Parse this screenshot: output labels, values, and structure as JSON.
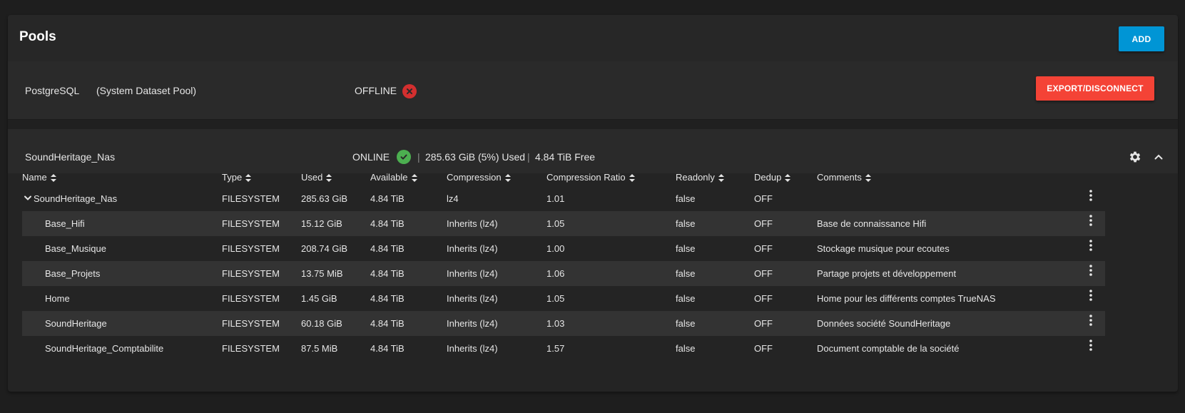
{
  "header": {
    "title": "Pools",
    "add_label": "ADD"
  },
  "offline_pool": {
    "name": "PostgreSQL",
    "subtitle": "(System Dataset Pool)",
    "status": "OFFLINE",
    "status_icon": "error-circle-icon",
    "export_label": "EXPORT/DISCONNECT"
  },
  "online_pool": {
    "name": "SoundHeritage_Nas",
    "status": "ONLINE",
    "status_icon": "check-circle-icon",
    "used": "285.63 GiB (5%) Used",
    "free": "4.84 TiB Free",
    "separator": "|"
  },
  "table": {
    "columns": [
      "Name",
      "Type",
      "Used",
      "Available",
      "Compression",
      "Compression Ratio",
      "Readonly",
      "Dedup",
      "Comments"
    ],
    "rows": [
      {
        "name": "SoundHeritage_Nas",
        "type": "FILESYSTEM",
        "used": "285.63 GiB",
        "available": "4.84 TiB",
        "compression": "lz4",
        "ratio": "1.01",
        "readonly": "false",
        "dedup": "OFF",
        "comments": ""
      },
      {
        "name": "Base_Hifi",
        "type": "FILESYSTEM",
        "used": "15.12 GiB",
        "available": "4.84 TiB",
        "compression": "Inherits (lz4)",
        "ratio": "1.05",
        "readonly": "false",
        "dedup": "OFF",
        "comments": "Base de connaissance Hifi"
      },
      {
        "name": "Base_Musique",
        "type": "FILESYSTEM",
        "used": "208.74 GiB",
        "available": "4.84 TiB",
        "compression": "Inherits (lz4)",
        "ratio": "1.00",
        "readonly": "false",
        "dedup": "OFF",
        "comments": "Stockage musique pour ecoutes"
      },
      {
        "name": "Base_Projets",
        "type": "FILESYSTEM",
        "used": "13.75 MiB",
        "available": "4.84 TiB",
        "compression": "Inherits (lz4)",
        "ratio": "1.06",
        "readonly": "false",
        "dedup": "OFF",
        "comments": "Partage projets et développement"
      },
      {
        "name": "Home",
        "type": "FILESYSTEM",
        "used": "1.45 GiB",
        "available": "4.84 TiB",
        "compression": "Inherits (lz4)",
        "ratio": "1.05",
        "readonly": "false",
        "dedup": "OFF",
        "comments": "Home pour les différents comptes TrueNAS"
      },
      {
        "name": "SoundHeritage",
        "type": "FILESYSTEM",
        "used": "60.18 GiB",
        "available": "4.84 TiB",
        "compression": "Inherits (lz4)",
        "ratio": "1.03",
        "readonly": "false",
        "dedup": "OFF",
        "comments": "Données société SoundHeritage"
      },
      {
        "name": "SoundHeritage_Comptabilite",
        "type": "FILESYSTEM",
        "used": "87.5 MiB",
        "available": "4.84 TiB",
        "compression": "Inherits (lz4)",
        "ratio": "1.57",
        "readonly": "false",
        "dedup": "OFF",
        "comments": "Document comptable de la société"
      }
    ]
  },
  "colors": {
    "accent": "#0095d5",
    "danger": "#f44336",
    "success": "#4caf50",
    "error_icon": "#d32f2f"
  }
}
